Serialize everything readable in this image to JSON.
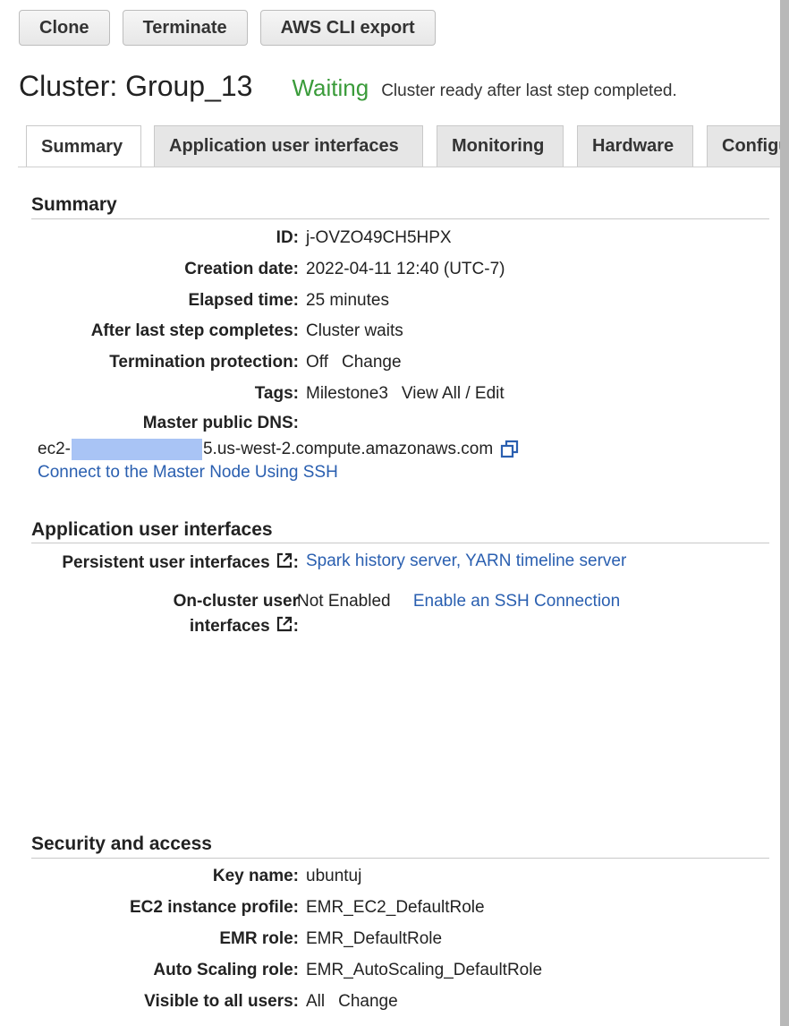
{
  "toolbar": {
    "clone_label": "Clone",
    "terminate_label": "Terminate",
    "cli_export_label": "AWS CLI export"
  },
  "header": {
    "title": "Cluster: Group_13",
    "status": "Waiting",
    "status_message": "Cluster ready after last step completed."
  },
  "tabs": [
    {
      "label": "Summary",
      "active": true
    },
    {
      "label": "Application user interfaces"
    },
    {
      "label": "Monitoring"
    },
    {
      "label": "Hardware"
    },
    {
      "label": "Configu"
    }
  ],
  "summary": {
    "title": "Summary",
    "id_label": "ID:",
    "id_value": "j-OVZO49CH5HPX",
    "creation_label": "Creation date:",
    "creation_value": "2022-04-11 12:40 (UTC-7)",
    "elapsed_label": "Elapsed time:",
    "elapsed_value": "25 minutes",
    "after_step_label": "After last step completes:",
    "after_step_value": "Cluster waits",
    "termination_label": "Termination protection:",
    "termination_value": "Off",
    "termination_change": "Change",
    "tags_label": "Tags:",
    "tags_value": "Milestone3",
    "tags_link": "View All / Edit",
    "dns_label": "Master public DNS:",
    "dns_prefix": "ec2-",
    "dns_suffix": "5.us-west-2.compute.amazonaws.com",
    "ssh_link": "Connect to the Master Node Using SSH"
  },
  "app_ui": {
    "title": "Application user interfaces",
    "persistent_label": "Persistent user interfaces",
    "spark_link": "Spark history server",
    "separator": ",",
    "yarn_link": "YARN timeline server",
    "oncluster_label_line1": "On-cluster user",
    "oncluster_label_line2": "interfaces",
    "oncluster_value": "Not Enabled",
    "oncluster_link": "Enable an SSH Connection"
  },
  "security": {
    "title": "Security and access",
    "key_label": "Key name:",
    "key_value": "ubuntuj",
    "ec2_label": "EC2 instance profile:",
    "ec2_value": "EMR_EC2_DefaultRole",
    "emr_label": "EMR role:",
    "emr_value": "EMR_DefaultRole",
    "auto_label": "Auto Scaling role:",
    "auto_value": "EMR_AutoScaling_DefaultRole",
    "visible_label": "Visible to all users:",
    "visible_value": "All",
    "visible_change": "Change"
  },
  "colors": {
    "status_green": "#3a9b3a",
    "link_blue": "#2a5fb0",
    "redaction": "#a9c4f5"
  }
}
